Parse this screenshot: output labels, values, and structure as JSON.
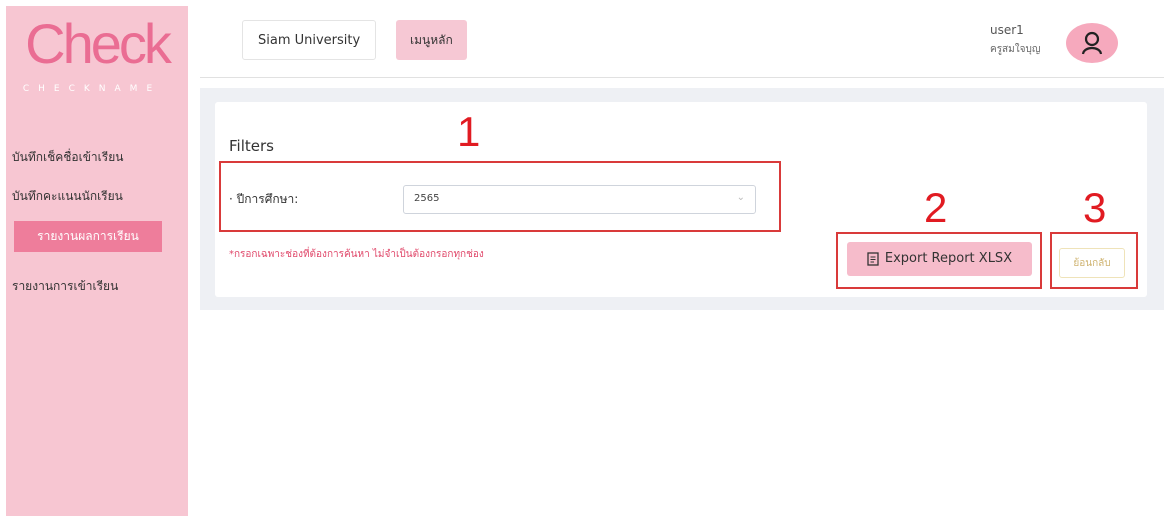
{
  "sidebar": {
    "logo": "Check",
    "logo_sub": "CHECKNAME",
    "items": [
      {
        "label": "บันทึกเช็คชื่อเข้าเรียน"
      },
      {
        "label": "บันทึกคะแนนนักเรียน"
      },
      {
        "label": "รายงานผลการเรียน"
      },
      {
        "label": "รายงานการเข้าเรียน"
      }
    ]
  },
  "topbar": {
    "university": "Siam University",
    "main_menu": "เมนูหลัก",
    "user_name": "user1",
    "user_role": "ครูสมใจบุญ"
  },
  "filters": {
    "title": "Filters",
    "year_label": "ปีการศึกษา:",
    "year_value": "2565",
    "note": "*กรอกเฉพาะช่องที่ต้องการค้นหา ไม่จำเป็นต้องกรอกทุกช่อง"
  },
  "actions": {
    "export_label": "Export Report XLSX",
    "back_label": "ย้อนกลับ"
  },
  "annotations": [
    "1",
    "2",
    "3"
  ],
  "colors": {
    "sidebar": "#f7c6d2",
    "accent": "#ee7d9b",
    "annotation": "#e11b22"
  }
}
